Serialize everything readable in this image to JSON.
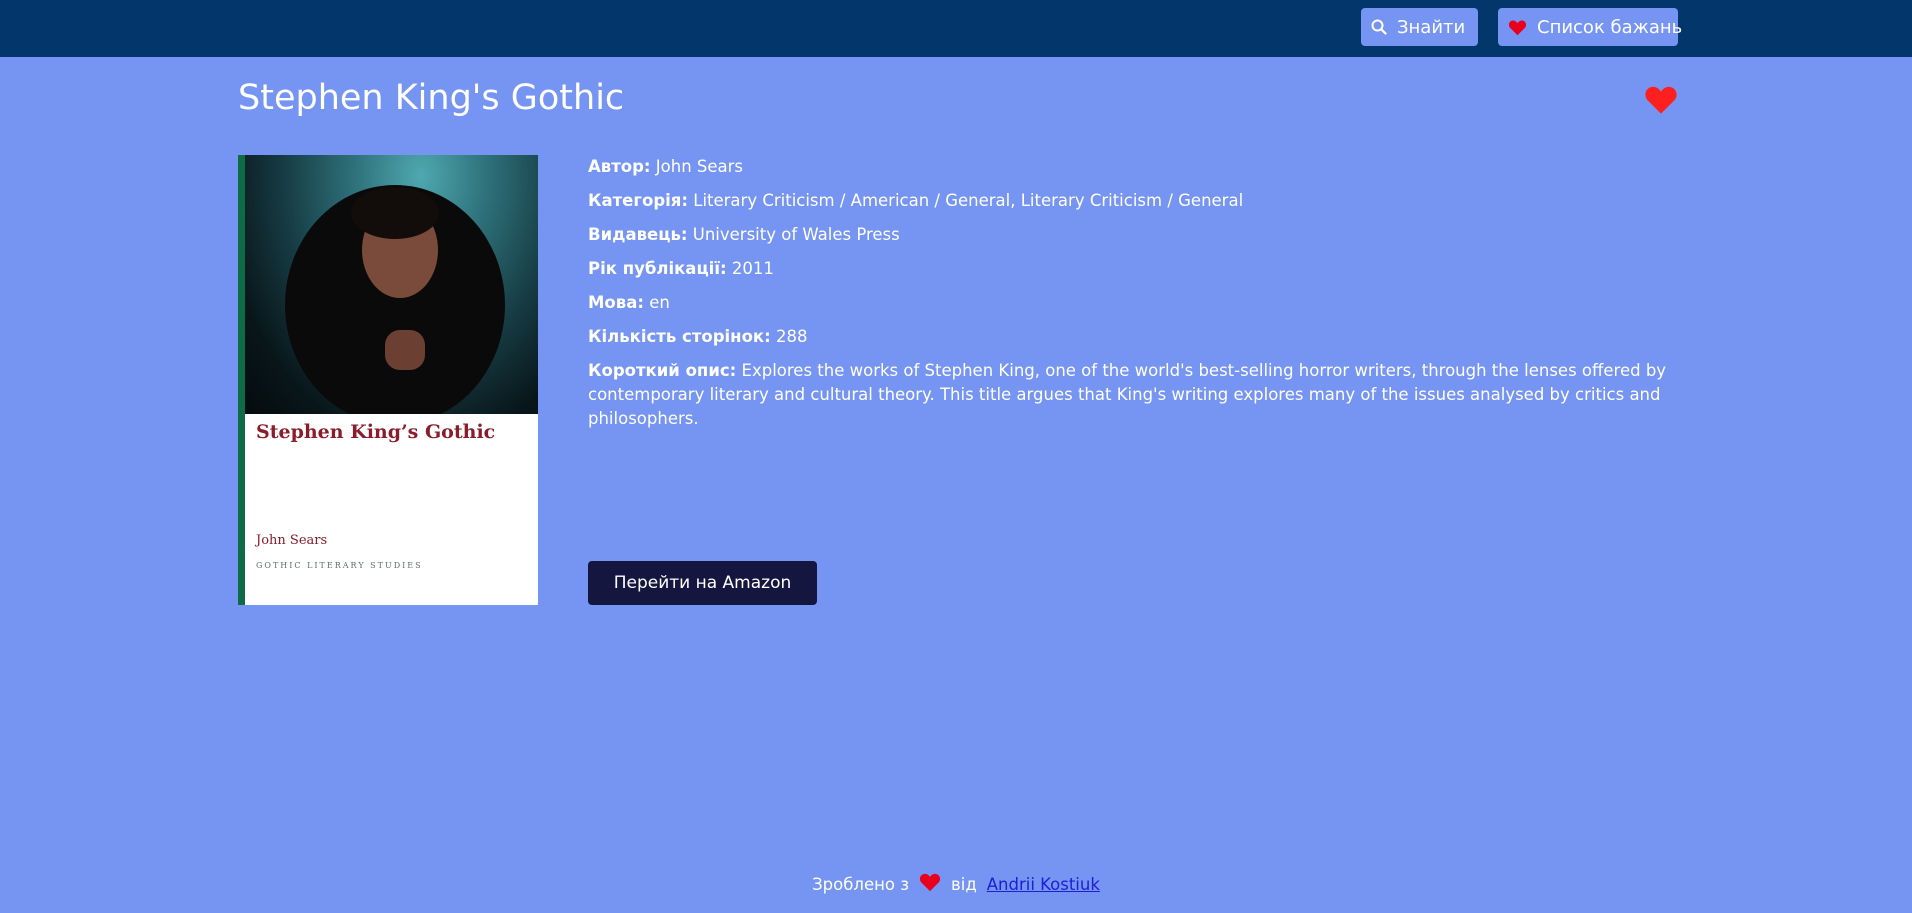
{
  "nav": {
    "search_label": "Знайти",
    "search_icon": "search-icon",
    "wishlist_label": "Список бажань",
    "wishlist_icon": "heart-icon"
  },
  "book": {
    "title": "Stephen King's Gothic",
    "favorite_icon": "heart-icon",
    "cover": {
      "title": "Stephen King’s Gothic",
      "author": "John Sears",
      "series": "GOTHIC LITERARY STUDIES"
    },
    "details": {
      "author_label": "Автор:",
      "author": "John Sears",
      "category_label": "Категорія:",
      "category": "Literary Criticism / American / General, Literary Criticism / General",
      "publisher_label": "Видавець:",
      "publisher": "University of Wales Press",
      "year_label": "Рік публікації:",
      "year": "2011",
      "language_label": "Мова:",
      "language": "en",
      "pages_label": "Кількість сторінок:",
      "pages": "288",
      "description_label": "Короткий опис:",
      "description": "Explores the works of Stephen King, one of the world's best-selling horror writers, through the lenses offered by contemporary literary and cultural theory. This title argues that King's writing explores many of the issues analysed by critics and philosophers."
    },
    "amazon_label": "Перейти на Amazon"
  },
  "footer": {
    "made_with": "Зроблено з",
    "by": "від",
    "author_link": "Andrii Kostiuk"
  },
  "colors": {
    "background": "#7694f2",
    "topbar": "#03366a",
    "heart": "#ff1f1f",
    "amazon_button": "#14163f",
    "link": "#1b1fd6"
  }
}
